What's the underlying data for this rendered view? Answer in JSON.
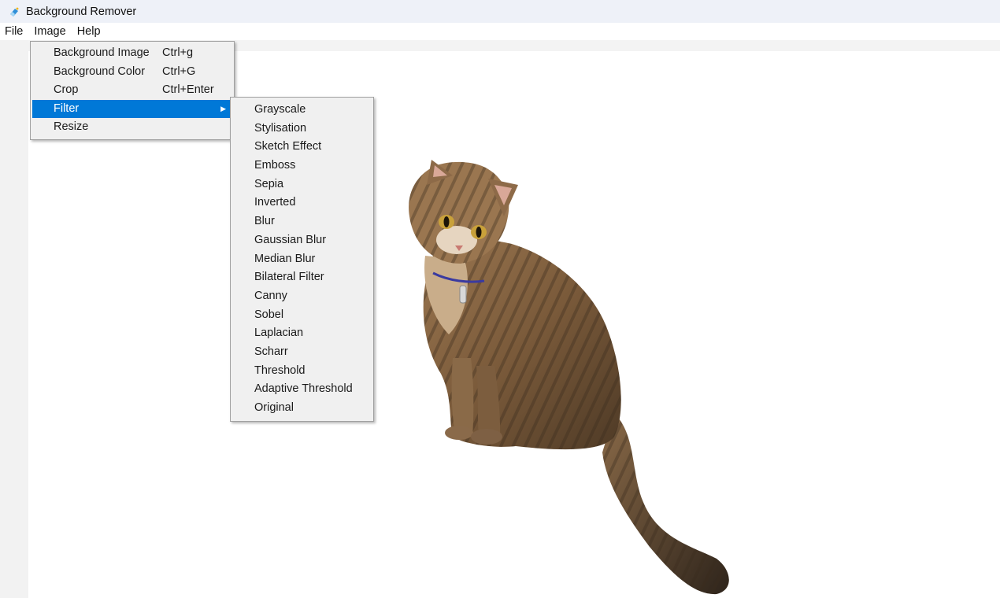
{
  "window": {
    "title": "Background Remover",
    "app_icon": "eraser-icon"
  },
  "menubar": {
    "items": [
      {
        "label": "File"
      },
      {
        "label": "Image"
      },
      {
        "label": "Help"
      }
    ]
  },
  "image_menu": {
    "items": [
      {
        "label": "Background Image",
        "shortcut": "Ctrl+g"
      },
      {
        "label": "Background Color",
        "shortcut": "Ctrl+G"
      },
      {
        "label": "Crop",
        "shortcut": "Ctrl+Enter"
      },
      {
        "label": "Filter",
        "shortcut": "",
        "has_submenu": true,
        "highlighted": true
      },
      {
        "label": "Resize",
        "shortcut": ""
      }
    ]
  },
  "filter_submenu": {
    "items": [
      {
        "label": "Grayscale"
      },
      {
        "label": "Stylisation"
      },
      {
        "label": "Sketch Effect"
      },
      {
        "label": "Emboss"
      },
      {
        "label": "Sepia"
      },
      {
        "label": "Inverted"
      },
      {
        "label": "Blur"
      },
      {
        "label": "Gaussian Blur"
      },
      {
        "label": "Median Blur"
      },
      {
        "label": "Bilateral Filter"
      },
      {
        "label": "Canny"
      },
      {
        "label": "Sobel"
      },
      {
        "label": "Laplacian"
      },
      {
        "label": "Scharr"
      },
      {
        "label": "Threshold"
      },
      {
        "label": "Adaptive Threshold"
      },
      {
        "label": "Original"
      }
    ]
  },
  "canvas": {
    "image_subject": "cat photo with background removed"
  },
  "colors": {
    "highlight": "#0078d7",
    "menu_bg": "#f0f0f0",
    "titlebar_bg": "#eef1f8"
  }
}
